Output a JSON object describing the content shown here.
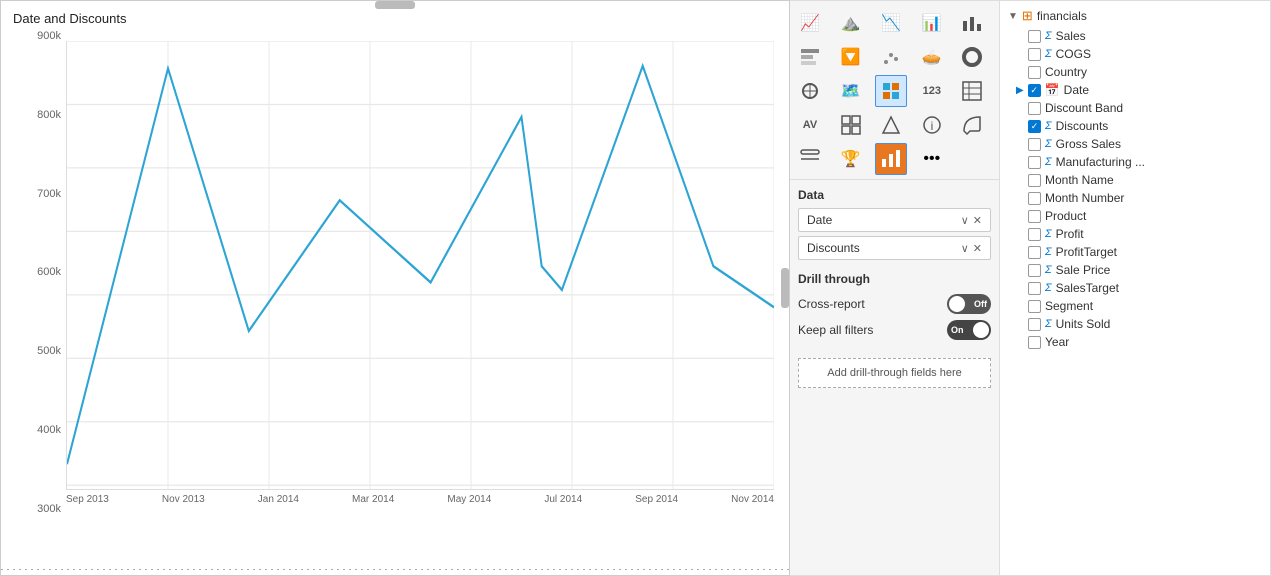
{
  "chart": {
    "title": "Date and Discounts",
    "y_labels": [
      "900k",
      "800k",
      "700k",
      "600k",
      "500k",
      "400k",
      "300k"
    ],
    "x_labels": [
      "Sep 2013",
      "Nov 2013",
      "Jan 2014",
      "Mar 2014",
      "May 2014",
      "Jul 2014",
      "Sep 2014",
      "Nov 2014"
    ],
    "line_color": "#2ca4d4"
  },
  "viz_panel": {
    "data_label": "Data",
    "pills": [
      {
        "label": "Date",
        "id": "date-pill"
      },
      {
        "label": "Discounts",
        "id": "discounts-pill"
      }
    ],
    "drill_through": {
      "title": "Drill through",
      "cross_report_label": "Cross-report",
      "cross_report_state": "Off",
      "keep_filters_label": "Keep all filters",
      "keep_filters_state": "On",
      "add_fields_label": "Add drill-through fields here"
    }
  },
  "fields_panel": {
    "parent": {
      "name": "financials",
      "icon": "table"
    },
    "fields": [
      {
        "name": "Sales",
        "type": "sigma",
        "checked": false
      },
      {
        "name": "COGS",
        "type": "sigma",
        "checked": false
      },
      {
        "name": "Country",
        "type": "plain",
        "checked": false
      },
      {
        "name": "Date",
        "type": "calendar",
        "checked": true,
        "expanded": true
      },
      {
        "name": "Discount Band",
        "type": "plain",
        "checked": false
      },
      {
        "name": "Discounts",
        "type": "sigma",
        "checked": true
      },
      {
        "name": "Gross Sales",
        "type": "sigma",
        "checked": false
      },
      {
        "name": "Manufacturing ...",
        "type": "sigma",
        "checked": false
      },
      {
        "name": "Month Name",
        "type": "plain",
        "checked": false
      },
      {
        "name": "Month Number",
        "type": "plain",
        "checked": false
      },
      {
        "name": "Product",
        "type": "plain",
        "checked": false
      },
      {
        "name": "Profit",
        "type": "sigma",
        "checked": false
      },
      {
        "name": "ProfitTarget",
        "type": "sigma",
        "checked": false
      },
      {
        "name": "Sale Price",
        "type": "sigma",
        "checked": false
      },
      {
        "name": "SalesTarget",
        "type": "sigma",
        "checked": false
      },
      {
        "name": "Segment",
        "type": "plain",
        "checked": false
      },
      {
        "name": "Units Sold",
        "type": "sigma",
        "checked": false
      },
      {
        "name": "Year",
        "type": "plain",
        "checked": false
      }
    ]
  }
}
